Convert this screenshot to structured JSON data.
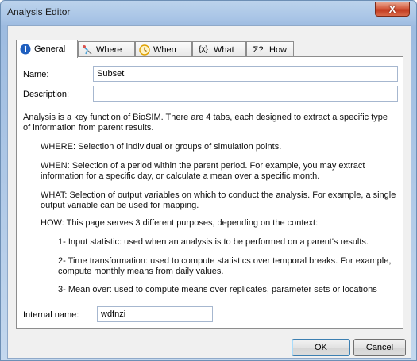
{
  "window": {
    "title": "Analysis Editor",
    "close_label": "X"
  },
  "tabs": [
    {
      "label": "General",
      "icon": "info-icon"
    },
    {
      "label": "Where",
      "icon": "pin-icon"
    },
    {
      "label": "When",
      "icon": "clock-icon"
    },
    {
      "label": "What",
      "icon": "variable-icon",
      "icon_text": "{x}"
    },
    {
      "label": "How",
      "icon": "sigma-icon",
      "icon_text": "Σ?"
    }
  ],
  "form": {
    "name_label": "Name:",
    "name_value": "Subset",
    "description_label": "Description:",
    "description_value": "",
    "internal_name_label": "Internal name:",
    "internal_name_value": "wdfnzi"
  },
  "help": {
    "intro_1": "Analysis is a key function of BioSIM. There are 4 tabs, each designed to extract a specific type",
    "intro_2": "of information from parent results.",
    "where": "WHERE: Selection of individual or groups of simulation points.",
    "when_1": "WHEN: Selection of a period within the parent period. For example, you may extract",
    "when_2": "information for a specific day, or calculate a mean over a specific month.",
    "what_1": "WHAT: Selection of output variables on which to conduct the analysis. For example, a single",
    "what_2": "output variable can be used for mapping.",
    "how": "HOW: This page serves 3 different purposes, depending on the context:",
    "how_1": "1- Input statistic: used when an analysis is to be performed on a parent's results.",
    "how_2a": "2- Time transformation: used to compute statistics over temporal breaks. For example,",
    "how_2b": "compute monthly means from daily values.",
    "how_3": "3- Mean over: used to compute means over replicates, parameter sets or locations"
  },
  "buttons": {
    "ok": "OK",
    "cancel": "Cancel"
  },
  "colors": {
    "accent": "#3c7fb1",
    "close_red": "#c23a1f",
    "frame": "#a9c5e6"
  }
}
